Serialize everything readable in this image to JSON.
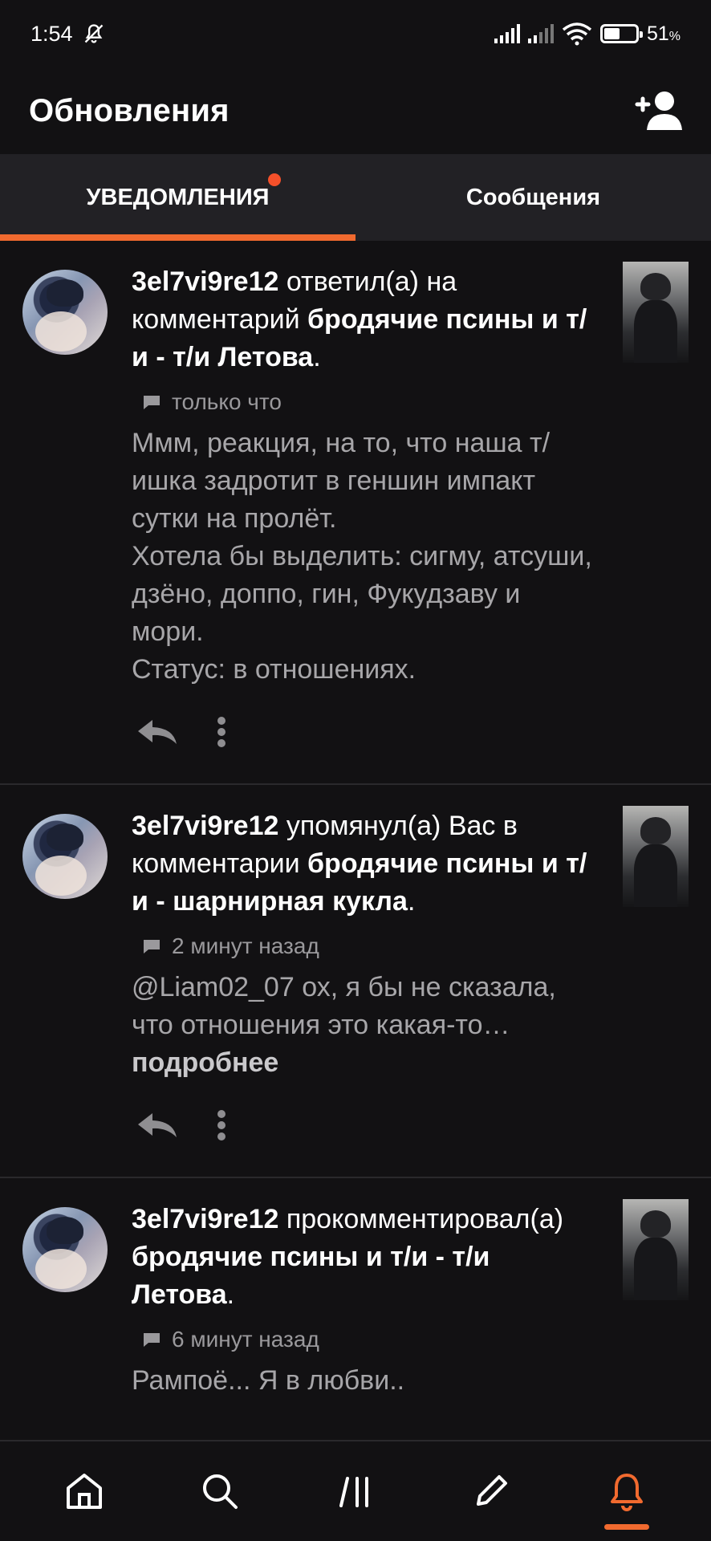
{
  "status_bar": {
    "time": "1:54",
    "battery": "51",
    "battery_unit": "%",
    "battery_level": 0.51
  },
  "header": {
    "title": "Обновления"
  },
  "tabs": [
    {
      "label": "УВЕДОМЛЕНИЯ",
      "active": true,
      "has_dot": true
    },
    {
      "label": "Сообщения",
      "active": false,
      "has_dot": false
    }
  ],
  "notifications": [
    {
      "user": "3el7vi9re12",
      "action": " ответил(а) на комментарий ",
      "story": "бродячие псины и т/и - т/и Летова",
      "end": ".",
      "time": "только что",
      "text": "Ммм, реакция, на то, что наша т/ишка задротит в геншин импакт сутки на пролёт.\nХотела бы выделить: сигму, атсуши, дзёно, доппо, гин, Фукудзаву и мори.\nСтатус: в отношениях.",
      "more": ""
    },
    {
      "user": "3el7vi9re12",
      "action": " упомянул(а) Вас в комментарии ",
      "story": "бродячие псины и т/и - шарнирная кукла",
      "end": ".",
      "time": "2 минут назад",
      "text": "@Liam02_07 ох, я бы не сказала, что отношения это какая-то… ",
      "more": "подробнее"
    },
    {
      "user": "3el7vi9re12",
      "action": " прокомментировал(а) ",
      "story": "бродячие псины и т/и - т/и Летова",
      "end": ".",
      "time": "6 минут назад",
      "text": "Рампоё... Я в любви..",
      "more": ""
    }
  ],
  "bottom_nav": [
    {
      "icon": "home-icon",
      "active": false
    },
    {
      "icon": "search-icon",
      "active": false
    },
    {
      "icon": "library-icon",
      "active": false
    },
    {
      "icon": "write-icon",
      "active": false
    },
    {
      "icon": "bell-icon",
      "active": true
    }
  ],
  "colors": {
    "accent": "#f16a2f",
    "background": "#121113",
    "tab_bar": "#222125",
    "secondary_text": "#a7a6a9"
  }
}
